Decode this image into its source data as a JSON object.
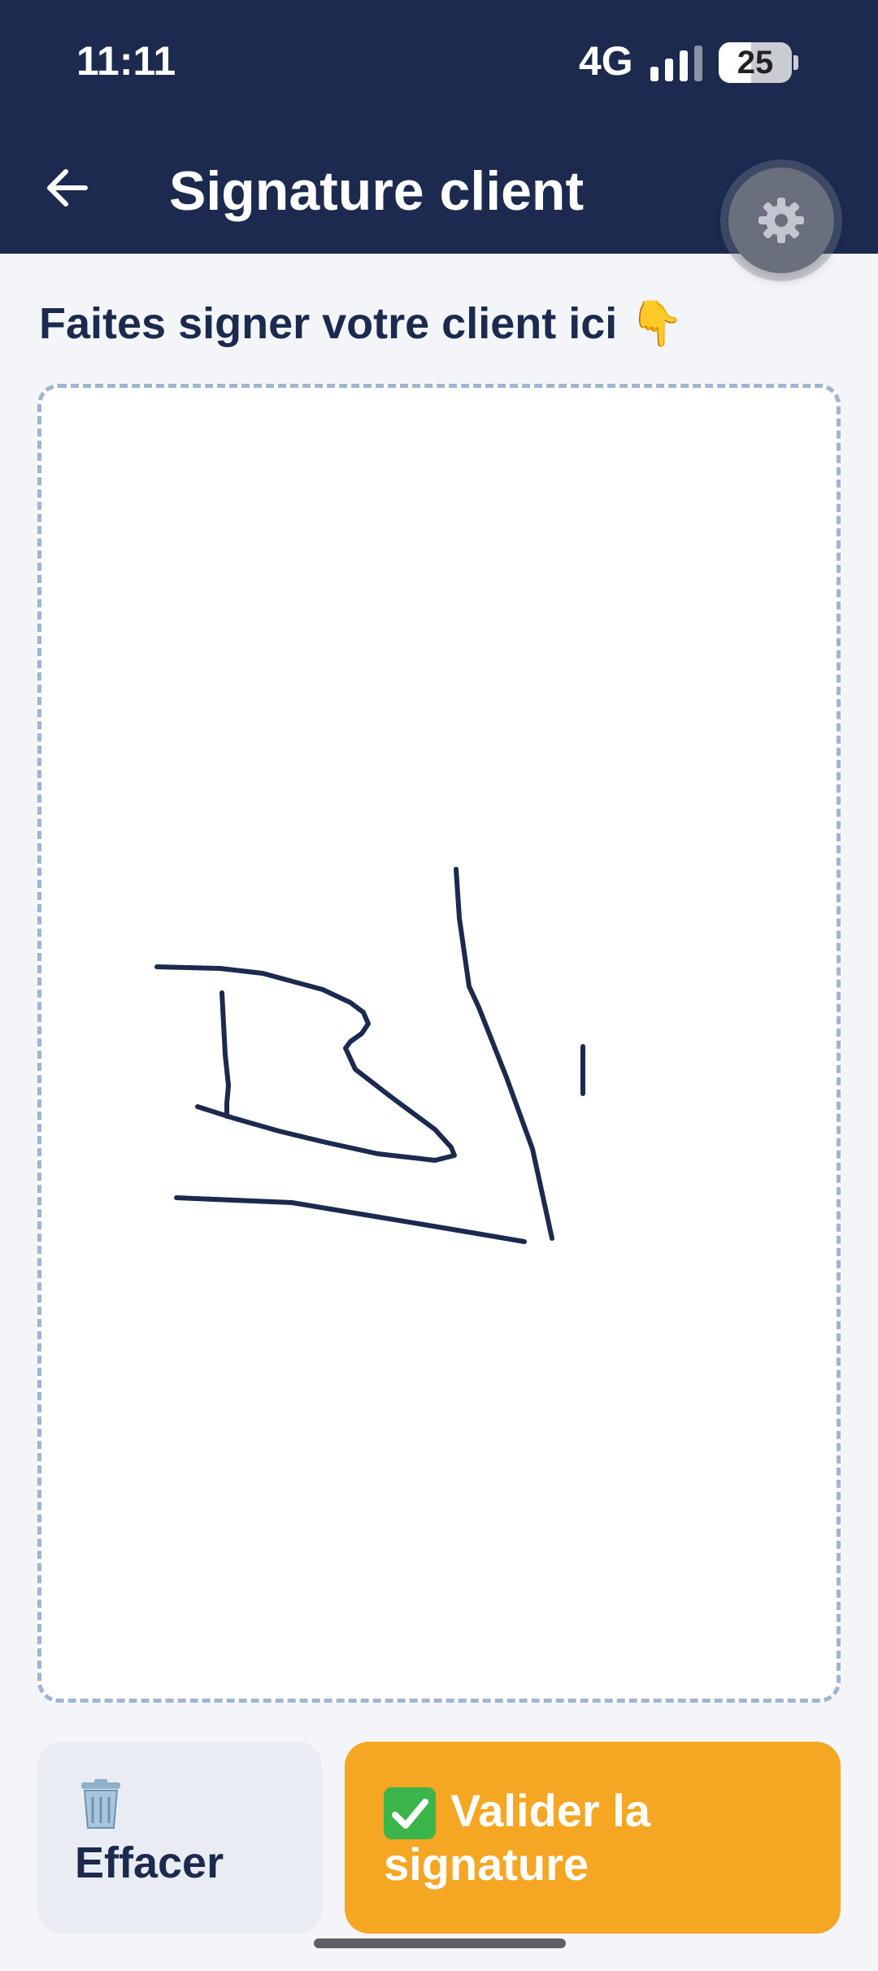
{
  "status_bar": {
    "time": "11:11",
    "network": "4G",
    "battery_level": "25",
    "signal_icon": "signal-bars-icon"
  },
  "header": {
    "title": "Signature client",
    "back_icon": "arrow-left-icon",
    "settings_icon": "gear-icon",
    "background_color": "#1b2a4e"
  },
  "instruction": {
    "text": "Faites signer votre client ici",
    "emoji": "👇"
  },
  "signature_pad": {
    "border_color": "#9fb5d0",
    "stroke_color": "#1b2a4e"
  },
  "actions": {
    "clear_label": "Effacer",
    "clear_icon": "trash-icon",
    "validate_label": "Valider la signature",
    "validate_icon": "check-icon",
    "validate_color": "#f5a623"
  }
}
